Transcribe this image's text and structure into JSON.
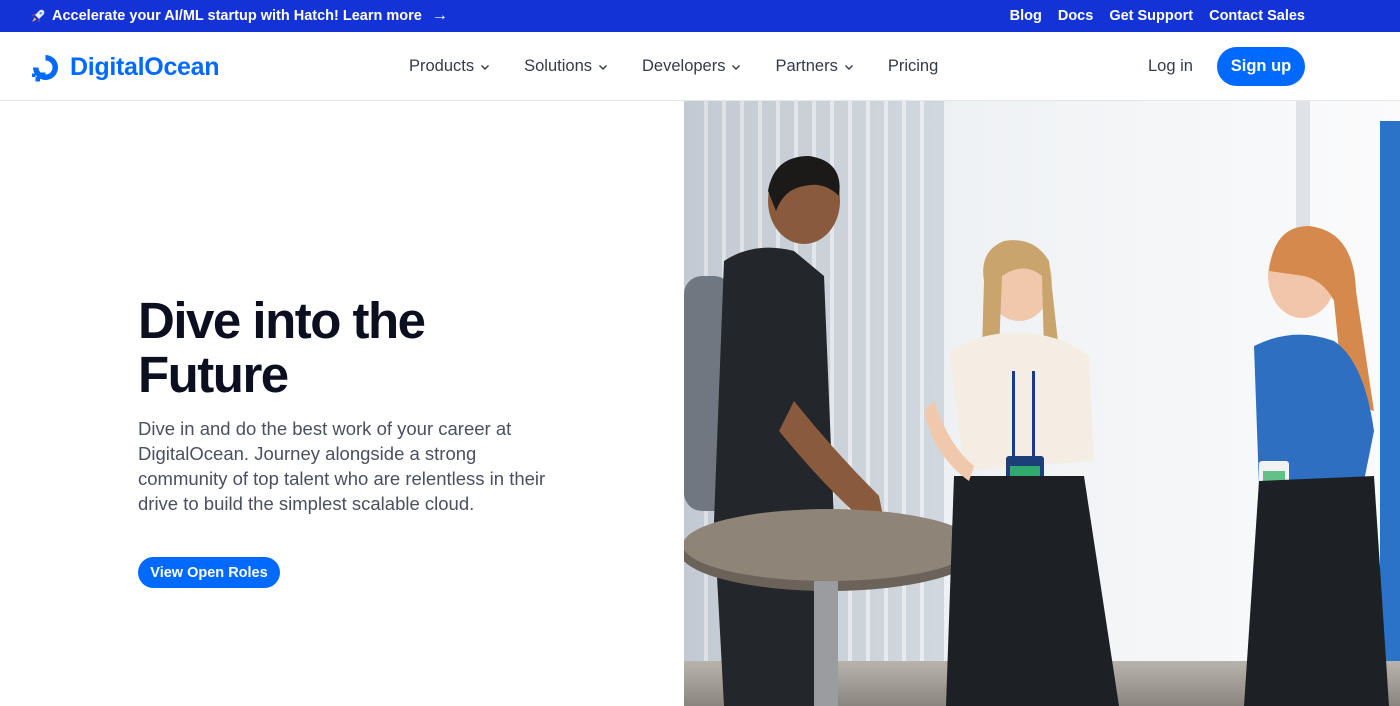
{
  "announcement": {
    "promo_text": "Accelerate your AI/ML startup with Hatch! Learn more",
    "arrow": "→",
    "links": [
      "Blog",
      "Docs",
      "Get Support",
      "Contact Sales"
    ]
  },
  "header": {
    "logo_text": "DigitalOcean",
    "nav": [
      {
        "label": "Products",
        "dropdown": true
      },
      {
        "label": "Solutions",
        "dropdown": true
      },
      {
        "label": "Developers",
        "dropdown": true
      },
      {
        "label": "Partners",
        "dropdown": true
      },
      {
        "label": "Pricing",
        "dropdown": false
      }
    ],
    "login_label": "Log in",
    "signup_label": "Sign up"
  },
  "hero": {
    "headline": "Dive into the Future",
    "body": "Dive in and do the best work of your career at DigitalOcean. Journey alongside a strong community of top talent who are relentless in their drive to build the simplest scalable cloud.",
    "cta_label": "View Open Roles"
  },
  "colors": {
    "topbar_bg": "#1433d6",
    "brand_blue": "#0069ff",
    "headline": "#0b0f1f",
    "body_text": "#4a5060"
  },
  "icons": [
    "rocket-icon",
    "arrow-right-icon",
    "chevron-down-icon",
    "digitalocean-logo-icon"
  ]
}
